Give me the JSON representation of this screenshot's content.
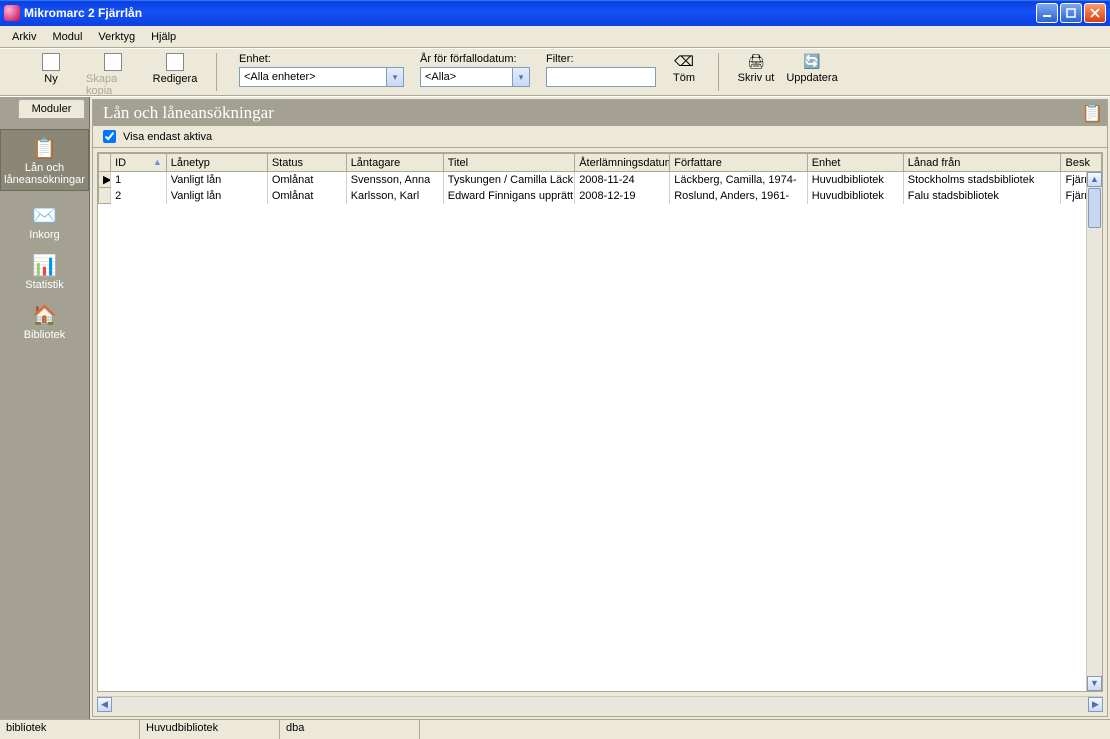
{
  "window": {
    "title": "Mikromarc 2 Fjärrlån"
  },
  "menu": {
    "arkiv": "Arkiv",
    "modul": "Modul",
    "verktyg": "Verktyg",
    "hjalp": "Hjälp"
  },
  "toolbar": {
    "ny": "Ny",
    "skapa_kopia": "Skapa kopia",
    "redigera": "Redigera",
    "enhet_label": "Enhet:",
    "enhet_value": "<Alla enheter>",
    "ar_label": "År för förfallodatum:",
    "ar_value": "<Alla>",
    "filter_label": "Filter:",
    "filter_value": "",
    "tom": "Töm",
    "skriv_ut": "Skriv ut",
    "uppdatera": "Uppdatera"
  },
  "sidebar": {
    "tab": "Moduler",
    "items": [
      {
        "label": "Lån och låneansökningar",
        "icon": "📋"
      },
      {
        "label": "Inkorg",
        "icon": "✉️"
      },
      {
        "label": "Statistik",
        "icon": "📊"
      },
      {
        "label": "Bibliotek",
        "icon": "🏠"
      }
    ]
  },
  "content": {
    "header": "Lån och låneansökningar",
    "checkbox_label": "Visa endast aktiva",
    "checkbox_checked": true
  },
  "columns": {
    "id": "ID",
    "lanetyp": "Lånetyp",
    "status": "Status",
    "lantagare": "Låntagare",
    "titel": "Titel",
    "aterlamning": "Återlämningsdatum",
    "forfattare": "Författare",
    "enhet": "Enhet",
    "lanad_fran": "Lånad från",
    "besk": "Besk"
  },
  "rows": [
    {
      "id": "1",
      "lanetyp": "Vanligt lån",
      "status": "Omlånat",
      "lantagare": "Svensson, Anna",
      "titel": "Tyskungen / Camilla Läck",
      "aterlamning": "2008-11-24",
      "forfattare": "Läckberg, Camilla, 1974-",
      "enhet": "Huvudbibliotek",
      "lanad_fran": "Stockholms stadsbibliotek",
      "besk": "Fjärr"
    },
    {
      "id": "2",
      "lanetyp": "Vanligt lån",
      "status": "Omlånat",
      "lantagare": "Karlsson, Karl",
      "titel": "Edward Finnigans upprätt",
      "aterlamning": "2008-12-19",
      "forfattare": "Roslund, Anders, 1961-",
      "enhet": "Huvudbibliotek",
      "lanad_fran": "Falu stadsbibliotek",
      "besk": "Fjärr"
    }
  ],
  "statusbar": {
    "c1": "bibliotek",
    "c2": "Huvudbibliotek",
    "c3": "dba"
  }
}
